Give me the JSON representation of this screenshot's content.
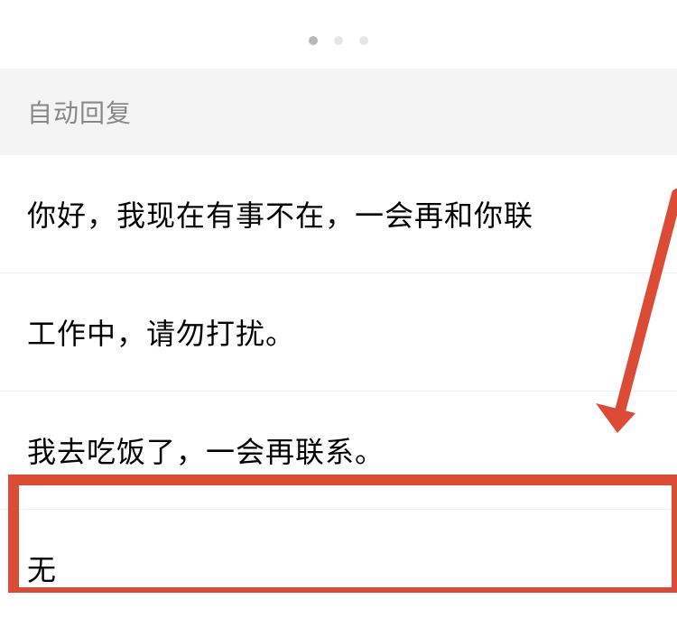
{
  "section_title": "自动回复",
  "items": [
    "你好，我现在有事不在，一会再和你联",
    "工作中，请勿打扰。",
    "我去吃饭了，一会再联系。",
    "无"
  ],
  "annotation": {
    "color": "#dc4b35",
    "stroke_width": 10
  }
}
